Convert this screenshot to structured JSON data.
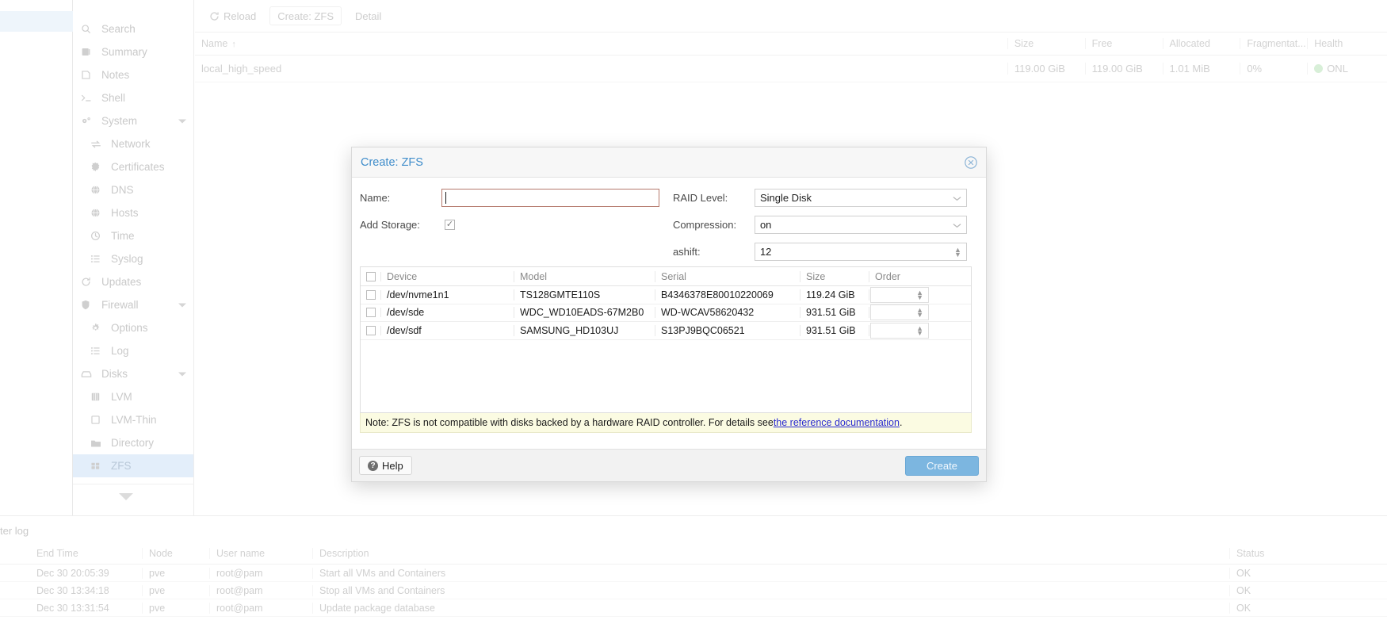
{
  "sidebar": {
    "items": [
      {
        "label": "Search",
        "icon": "search-icon",
        "sub": false,
        "caret": false,
        "selected": false
      },
      {
        "label": "Summary",
        "icon": "summary-icon",
        "sub": false,
        "caret": false,
        "selected": false
      },
      {
        "label": "Notes",
        "icon": "notes-icon",
        "sub": false,
        "caret": false,
        "selected": false
      },
      {
        "label": "Shell",
        "icon": "shell-icon",
        "sub": false,
        "caret": false,
        "selected": false
      },
      {
        "label": "System",
        "icon": "gear-icon",
        "sub": false,
        "caret": true,
        "selected": false
      },
      {
        "label": "Network",
        "icon": "network-icon",
        "sub": true,
        "caret": false,
        "selected": false
      },
      {
        "label": "Certificates",
        "icon": "certificate-icon",
        "sub": true,
        "caret": false,
        "selected": false
      },
      {
        "label": "DNS",
        "icon": "globe-icon",
        "sub": true,
        "caret": false,
        "selected": false
      },
      {
        "label": "Hosts",
        "icon": "globe-icon",
        "sub": true,
        "caret": false,
        "selected": false
      },
      {
        "label": "Time",
        "icon": "clock-icon",
        "sub": true,
        "caret": false,
        "selected": false
      },
      {
        "label": "Syslog",
        "icon": "list-icon",
        "sub": true,
        "caret": false,
        "selected": false
      },
      {
        "label": "Updates",
        "icon": "refresh-icon",
        "sub": false,
        "caret": false,
        "selected": false
      },
      {
        "label": "Firewall",
        "icon": "shield-icon",
        "sub": false,
        "caret": true,
        "selected": false
      },
      {
        "label": "Options",
        "icon": "cog-icon",
        "sub": true,
        "caret": false,
        "selected": false
      },
      {
        "label": "Log",
        "icon": "list-icon",
        "sub": true,
        "caret": false,
        "selected": false
      },
      {
        "label": "Disks",
        "icon": "disk-icon",
        "sub": false,
        "caret": true,
        "selected": false
      },
      {
        "label": "LVM",
        "icon": "lvm-icon",
        "sub": true,
        "caret": false,
        "selected": false
      },
      {
        "label": "LVM-Thin",
        "icon": "lvmthin-icon",
        "sub": true,
        "caret": false,
        "selected": false
      },
      {
        "label": "Directory",
        "icon": "folder-icon",
        "sub": true,
        "caret": false,
        "selected": false
      },
      {
        "label": "ZFS",
        "icon": "zfs-icon",
        "sub": true,
        "caret": false,
        "selected": true
      }
    ]
  },
  "toolbar": {
    "reload_label": "Reload",
    "create_zfs_label": "Create: ZFS",
    "detail_label": "Detail"
  },
  "pool_grid": {
    "columns": [
      "Name",
      "Size",
      "Free",
      "Allocated",
      "Fragmentat...",
      "Health"
    ],
    "sort_indicator": "↑",
    "rows": [
      {
        "name": "local_high_speed",
        "size": "119.00 GiB",
        "free": "119.00 GiB",
        "allocated": "1.01 MiB",
        "fragmentation": "0%",
        "health": "ONL"
      }
    ]
  },
  "task_log": {
    "title": "ter log",
    "columns": [
      "",
      "End Time",
      "Node",
      "User name",
      "Description",
      "Status"
    ],
    "rows": [
      {
        "end_time": "Dec 30 20:05:39",
        "node": "pve",
        "user": "root@pam",
        "description": "Start all VMs and Containers",
        "status": "OK"
      },
      {
        "end_time": "Dec 30 13:34:18",
        "node": "pve",
        "user": "root@pam",
        "description": "Stop all VMs and Containers",
        "status": "OK"
      },
      {
        "end_time": "Dec 30 13:31:54",
        "node": "pve",
        "user": "root@pam",
        "description": "Update package database",
        "status": "OK"
      }
    ]
  },
  "dialog": {
    "title": "Create: ZFS",
    "close_icon": "close-icon",
    "fields": {
      "name_label": "Name:",
      "name_value": "",
      "add_storage_label": "Add Storage:",
      "add_storage_checked": "✓",
      "raid_level_label": "RAID Level:",
      "raid_level_value": "Single Disk",
      "compression_label": "Compression:",
      "compression_value": "on",
      "ashift_label": "ashift:",
      "ashift_value": "12"
    },
    "disk_table": {
      "columns": [
        "",
        "Device",
        "Model",
        "Serial",
        "Size",
        "Order"
      ],
      "rows": [
        {
          "device": "/dev/nvme1n1",
          "model": "TS128GMTE110S",
          "serial": "B4346378E80010220069",
          "size": "119.24 GiB",
          "order": ""
        },
        {
          "device": "/dev/sde",
          "model": "WDC_WD10EADS-67M2B0",
          "serial": "WD-WCAV58620432",
          "size": "931.51 GiB",
          "order": ""
        },
        {
          "device": "/dev/sdf",
          "model": "SAMSUNG_HD103UJ",
          "serial": "S13PJ9BQC06521",
          "size": "931.51 GiB",
          "order": ""
        }
      ]
    },
    "note": {
      "prefix": "Note: ZFS is not compatible with disks backed by a hardware RAID controller. For details see ",
      "link": "the reference documentation",
      "suffix": "."
    },
    "footer": {
      "help_label": "Help",
      "create_label": "Create"
    }
  },
  "colors": {
    "link": "#3f8dcb",
    "primary_button": "#7cb6e0",
    "invalid_border": "#b5796c",
    "note_bg": "#fbfbe2",
    "selected_nav": "#e3eefa"
  }
}
